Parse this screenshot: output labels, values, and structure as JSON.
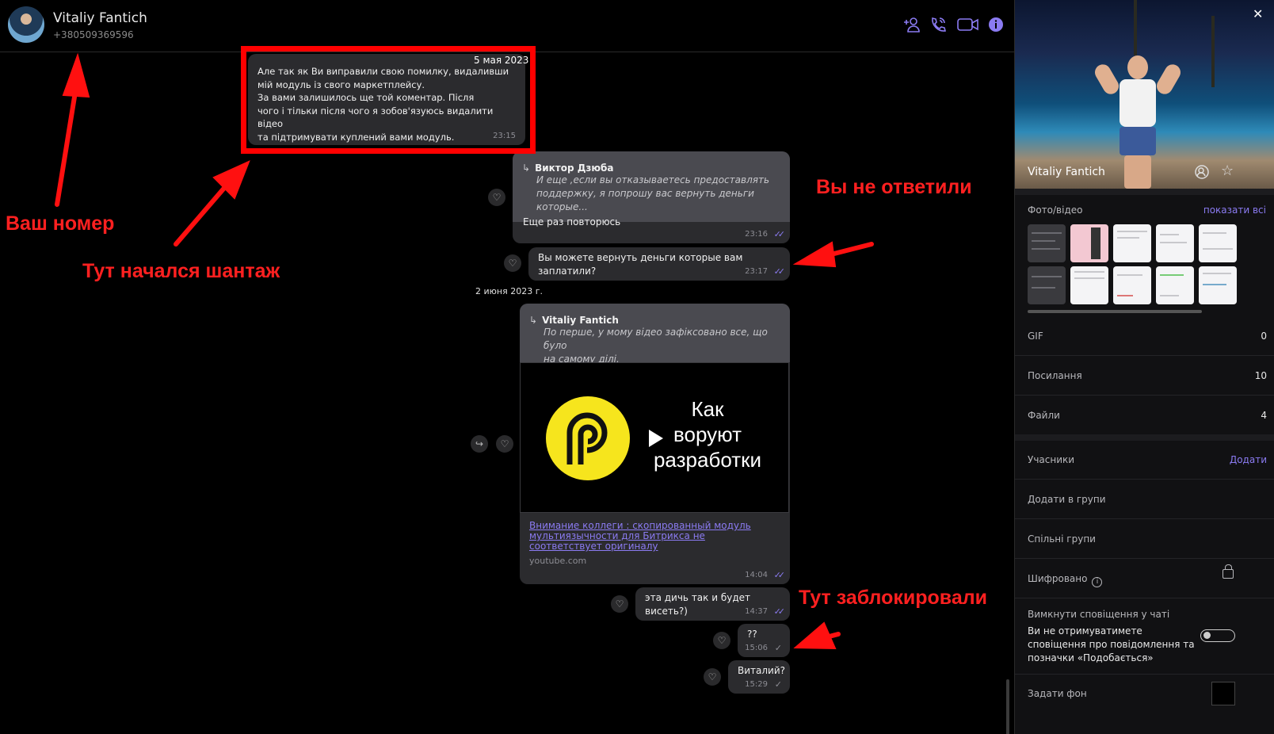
{
  "header": {
    "name": "Vitaliy Fantich",
    "phone": "+380509369596",
    "icons": [
      "add-user-icon",
      "phone-icon",
      "video-camera-icon",
      "info-icon"
    ]
  },
  "messages": {
    "m1": {
      "date": "5 мая 2023",
      "text": "Але так як Ви виправили свою помилку, видаливши\nмій модуль із свого маркетплейсу.\nЗа вами залишилось ще той коментар. Після\nчого і тільки після чого я зобов'язуюсь видалити відео\nта підтримувати куплений вами модуль.",
      "time": "23:15"
    },
    "m2": {
      "reply_author": "Виктор Дзюба",
      "reply_text": "И еще ,если вы отказываетесь предоставлять\nподдержку, я попрошу вас вернуть деньги которые...",
      "text": "Еще раз повторюсь",
      "time": "23:16"
    },
    "m3": {
      "text": "Вы можете вернуть деньги которые вам заплатили?",
      "time": "23:17"
    },
    "date2": "2 июня 2023 г.",
    "m4": {
      "reply_author": "Vitaliy Fantich",
      "reply_text": "По перше, у мому відео зафіксовано все, що було\nна самому ділі.",
      "video_title": "Как\nворуют\nразработки",
      "link_title": "Внимание коллеги : скопированный модуль мультиязычности для Битрикса не соответствует оригиналу",
      "link_domain": "youtube.com",
      "time": "14:04"
    },
    "m5": {
      "text": "эта дичь так и будет висеть?)",
      "time": "14:37"
    },
    "m6": {
      "text": "??",
      "time": "15:06"
    },
    "m7": {
      "text": "Виталий?",
      "time": "15:29"
    }
  },
  "annotations": {
    "your_number": "Ваш номер",
    "blackmail": "Тут начался шантаж",
    "no_answer": "Вы не ответили",
    "blocked": "Тут заблокировали"
  },
  "panel": {
    "profile_name": "Vitaliy Fantich",
    "media_label": "Фото/відео",
    "media_link": "показати всі",
    "gif_label": "GIF",
    "gif_count": "0",
    "links_label": "Посилання",
    "links_count": "10",
    "files_label": "Файли",
    "files_count": "4",
    "members_label": "Учасники",
    "members_link": "Додати",
    "add_to_groups": "Додати в групи",
    "common_groups": "Спільні групи",
    "encrypted": "Шифровано",
    "mute_title": "Вимкнути сповіщення у чаті",
    "mute_desc": "Ви не отримуватимете сповіщення про повідомлення та позначки «Подобається»",
    "set_background": "Задати фон"
  },
  "colors": {
    "accent": "#8b7bf2",
    "annotation": "#ff2020",
    "bubble": "#2b2b2e"
  }
}
